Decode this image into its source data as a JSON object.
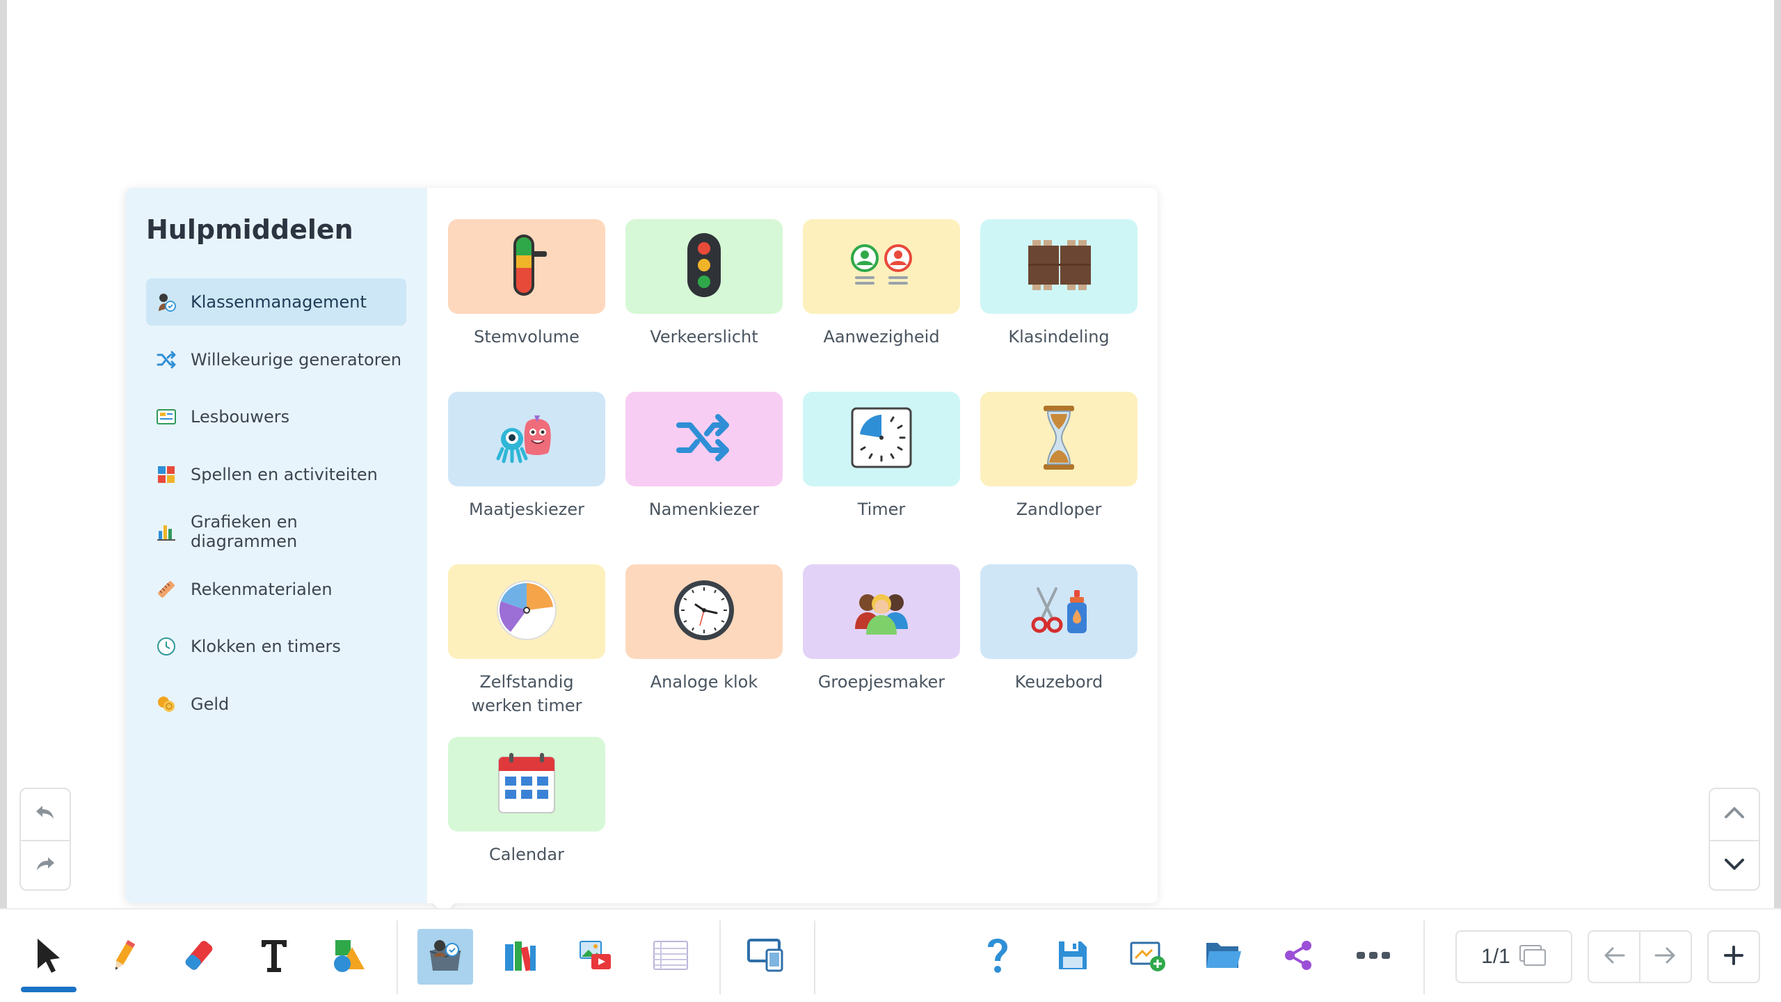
{
  "panel": {
    "title": "Hulpmiddelen",
    "categories": [
      {
        "label": "Klassenmanagement",
        "icon": "class-management-icon",
        "active": true
      },
      {
        "label": "Willekeurige generatoren",
        "icon": "shuffle-icon"
      },
      {
        "label": "Lesbouwers",
        "icon": "lesson-builder-icon"
      },
      {
        "label": "Spellen en activiteiten",
        "icon": "puzzle-icon"
      },
      {
        "label": "Grafieken en diagrammen",
        "icon": "bar-chart-icon"
      },
      {
        "label": "Rekenmaterialen",
        "icon": "ruler-icon"
      },
      {
        "label": "Klokken en timers",
        "icon": "clock-icon"
      },
      {
        "label": "Geld",
        "icon": "coins-icon"
      }
    ],
    "tools": [
      {
        "label": "Stemvolume",
        "icon": "voice-volume-icon",
        "bg": "#fdd8bd"
      },
      {
        "label": "Verkeerslicht",
        "icon": "traffic-light-icon",
        "bg": "#d6f8d6"
      },
      {
        "label": "Aanwezigheid",
        "icon": "attendance-icon",
        "bg": "#fdf0bd"
      },
      {
        "label": "Klasindeling",
        "icon": "seating-plan-icon",
        "bg": "#cff6f6"
      },
      {
        "label": "Maatjeskiezer",
        "icon": "monster-icon",
        "bg": "#cfe6f7"
      },
      {
        "label": "Namenkiezer",
        "icon": "shuffle-icon",
        "bg": "#f8cdf3"
      },
      {
        "label": "Timer",
        "icon": "timer-icon",
        "bg": "#cff6f6"
      },
      {
        "label": "Zandloper",
        "icon": "hourglass-icon",
        "bg": "#fdf0bd"
      },
      {
        "label": "Zelfstandig werken timer",
        "icon": "pie-timer-icon",
        "bg": "#fdf0bd"
      },
      {
        "label": "Analoge klok",
        "icon": "analog-clock-icon",
        "bg": "#fdd8bd"
      },
      {
        "label": "Groepjesmaker",
        "icon": "group-maker-icon",
        "bg": "#e3d2f7"
      },
      {
        "label": "Keuzebord",
        "icon": "scissors-glue-icon",
        "bg": "#cfe6f7"
      },
      {
        "label": "Calendar",
        "icon": "calendar-icon",
        "bg": "#d6f8d6"
      }
    ]
  },
  "toolbar": {
    "page_indicator": "1/1",
    "tools": [
      "select-arrow-icon",
      "pencil-icon",
      "eraser-icon",
      "text-icon",
      "shapes-icon",
      "toolbox-icon",
      "library-icon",
      "media-icon",
      "notes-icon",
      "screen-share-icon",
      "help-icon",
      "save-icon",
      "new-board-icon",
      "folder-icon",
      "share-icon",
      "more-icon"
    ]
  }
}
